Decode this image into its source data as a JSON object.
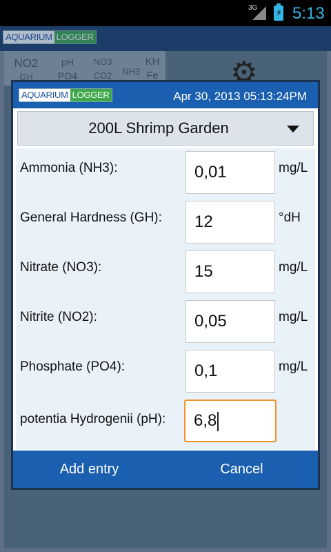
{
  "status_bar": {
    "network": "3G",
    "time": "5:13",
    "battery_icon": "battery-charging-icon",
    "signal_icon": "signal-icon"
  },
  "app": {
    "logo": {
      "part1": "AQUARIUM",
      "part2": "LOGGER"
    },
    "tabs": [
      {
        "top": "NO2",
        "bottom": "GH"
      },
      {
        "top": "pH",
        "bottom": "PO4"
      },
      {
        "top": "NO3",
        "bottom": "CO2"
      },
      {
        "top": "NH3",
        "bottom": ""
      },
      {
        "top": "KH",
        "bottom": "Fe"
      }
    ],
    "settings_icon": "gear-icon"
  },
  "dialog": {
    "logo": {
      "part1": "AQUARIUM",
      "part2": "LOGGER"
    },
    "date": "Apr 30, 2013 05:13:24PM",
    "tank": {
      "selected": "200L Shrimp Garden"
    },
    "fields": [
      {
        "label": "Ammonia (NH3):",
        "value": "0,01",
        "unit": "mg/L"
      },
      {
        "label": "General Hardness (GH):",
        "value": "12",
        "unit": "°dH"
      },
      {
        "label": "Nitrate (NO3):",
        "value": "15",
        "unit": "mg/L"
      },
      {
        "label": "Nitrite (NO2):",
        "value": "0,05",
        "unit": "mg/L"
      },
      {
        "label": "Phosphate (PO4):",
        "value": "0,1",
        "unit": "mg/L"
      },
      {
        "label": "potentia Hydrogenii (pH):",
        "value": "6,8",
        "unit": ""
      }
    ],
    "buttons": {
      "add": "Add entry",
      "cancel": "Cancel"
    }
  },
  "colors": {
    "accent": "#1a5fb0",
    "focus": "#f0932a",
    "status_time": "#33b5e5"
  }
}
